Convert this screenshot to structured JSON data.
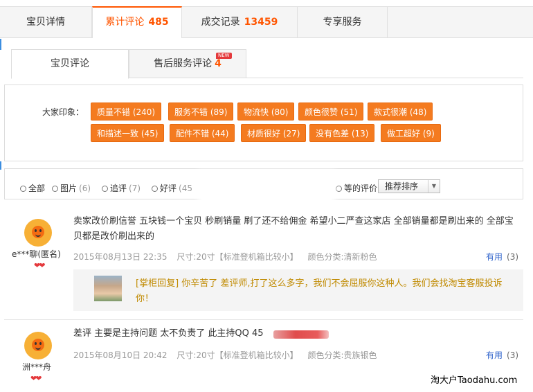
{
  "top_tabs": [
    {
      "label": "宝贝详情",
      "count": ""
    },
    {
      "label": "累计评论",
      "count": "485"
    },
    {
      "label": "成交记录",
      "count": "13459"
    },
    {
      "label": "专享服务",
      "count": ""
    }
  ],
  "sub_tabs": [
    {
      "label": "宝贝评论",
      "count": ""
    },
    {
      "label": "售后服务评论",
      "count": "4",
      "badge": "NEW"
    }
  ],
  "impressions": {
    "label": "大家印象：",
    "tags": [
      "质量不错 (240)",
      "服务不错 (89)",
      "物流快 (80)",
      "颜色很赞 (51)",
      "款式很潮 (48)",
      "和描述一致 (45)",
      "配件不错 (44)",
      "材质很好 (27)",
      "没有色差 (13)",
      "做工超好 (9)"
    ]
  },
  "filters": [
    {
      "label": "全部",
      "count": ""
    },
    {
      "label": "图片",
      "count": "(6)"
    },
    {
      "label": "追评",
      "count": "(7)"
    },
    {
      "label": "好评",
      "count": "(45"
    },
    {
      "label": "等的评价",
      "count": ""
    }
  ],
  "sort": {
    "value": "推荐排序",
    "icon": "triangle-down-icon"
  },
  "reviews": [
    {
      "user": "e***聊(匿名)",
      "hearts": "❤❤",
      "text": "卖家改价刷信誉 五块钱一个宝贝 秒刷销量 刷了还不给佣金 希望小二严查这家店 全部销量都是刷出来的 全部宝贝都是改价刷出来的",
      "date": "2015年08月13日 22:35",
      "size": "尺寸:20寸【标准登机箱比较小】",
      "color": "颜色分类:清新粉色",
      "useful": "有用",
      "useful_count": "(3)",
      "reply": "[掌柜回复] 你辛苦了 差评师,打了这么多字，我们不会屈服你这种人。我们会找淘宝客服投诉你！"
    },
    {
      "user": "洲***舟",
      "hearts": "❤❤",
      "text": "差评 主要是主持问题 太不负责了 此主持QQ 45",
      "date": "2015年08月10日 20:42",
      "size": "尺寸:20寸【标准登机箱比较小】",
      "color": "颜色分类:贵族银色",
      "useful": "有用",
      "useful_count": "(3)"
    }
  ],
  "watermark": "淘大户Taodahu.com",
  "colors": {
    "accent": "#ff5500",
    "tag": "#f47b20",
    "link": "#3366cc",
    "reply": "#c08a00"
  }
}
